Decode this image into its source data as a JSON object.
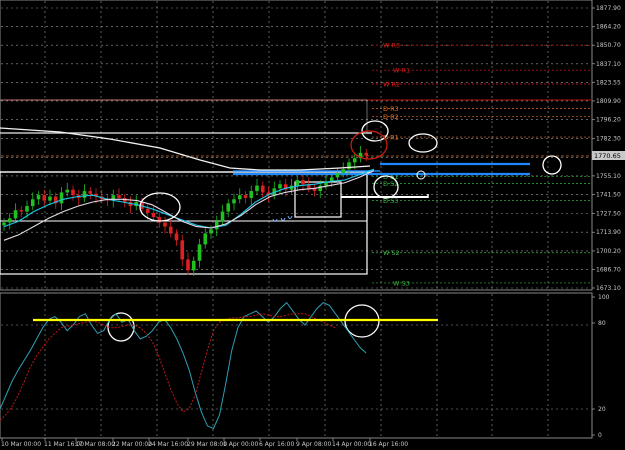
{
  "chart_data": [
    {
      "type": "line",
      "title": "",
      "price_scale": {
        "ticks": [
          "1877.90",
          "1864.20",
          "1850.70",
          "1837.10",
          "1823.55",
          "1809.90",
          "1796.20",
          "1782.30",
          "1768.40",
          "1755.10",
          "1741.50",
          "1727.50",
          "1713.90",
          "1700.20",
          "1686.70",
          "1673.10"
        ],
        "current_price": "1770.65",
        "ylim": [
          1673.1,
          1877.9
        ]
      },
      "time_axis": {
        "labels": [
          "10 Mar 00:00",
          "11 Mar 16:00",
          "17 Mar 08:00",
          "22 Mar 00:00",
          "24 Mar 16:00",
          "29 Mar 08:00",
          "1 Apr 00:00",
          "6 Apr 16:00",
          "9 Apr 08:00",
          "14 Apr 00:00",
          "16 Apr 16:00"
        ]
      },
      "levels": [
        {
          "label": "W R3",
          "price": 1850.7,
          "color": "#d81b1b"
        },
        {
          "label": "W R1",
          "price": 1832.4,
          "color": "#d81b1b"
        },
        {
          "label": "W R2",
          "price": 1822.3,
          "color": "#d81b1b"
        },
        {
          "label": "D R3",
          "price": 1804.5,
          "color": "#e0742a"
        },
        {
          "label": "D R2",
          "price": 1798.5,
          "color": "#e0742a"
        },
        {
          "label": "D R1",
          "price": 1783.5,
          "color": "#e0742a"
        },
        {
          "label": "D S1",
          "price": 1754.8,
          "color": "#3cb043"
        },
        {
          "label": "D S2",
          "price": 1749.6,
          "color": "#3cb043"
        },
        {
          "label": "D S3",
          "price": 1737.2,
          "color": "#3cb043"
        },
        {
          "label": "W S2",
          "price": 1698.9,
          "color": "#3cb043"
        },
        {
          "label": "W S3",
          "price": 1676.8,
          "color": "#3cb043"
        }
      ],
      "series": [
        {
          "values": [
            1718,
            1722,
            1729,
            1734,
            1738,
            1740,
            1741,
            1738,
            1736,
            1734,
            1731,
            1727,
            1723,
            1719,
            1717,
            1719,
            1727,
            1736,
            1742,
            1746,
            1748,
            1749,
            1751,
            1752,
            1756,
            1760
          ],
          "color": "#1ec8e8"
        },
        {
          "values": [
            1708,
            1712,
            1718,
            1724,
            1729,
            1733,
            1736,
            1738,
            1738,
            1737,
            1734,
            1728,
            1722,
            1718,
            1717,
            1720,
            1726,
            1734,
            1740,
            1743,
            1745,
            1746,
            1748,
            1750,
            1754,
            1759
          ],
          "color": "#e8d8e8"
        },
        {
          "values": [
            1785,
            1781,
            1777,
            1773,
            1770,
            1768,
            1766,
            1764,
            1762,
            1760,
            1758
          ],
          "color": "#f2f2f2"
        }
      ]
    },
    {
      "type": "line",
      "title": "",
      "y_ticks": [
        "100",
        "80",
        "20",
        "0"
      ],
      "ylim": [
        0,
        100
      ],
      "horizontal_line": 80,
      "series": [
        {
          "values": [
            20,
            30,
            40,
            48,
            55,
            62,
            70,
            78,
            84,
            86,
            82,
            76,
            80,
            86,
            88,
            80,
            74,
            76,
            84,
            88,
            82,
            84,
            76,
            70,
            72,
            76,
            82,
            84,
            78,
            70,
            60,
            48,
            32,
            18,
            8,
            6,
            16,
            38,
            62,
            78,
            86,
            88,
            90,
            86,
            82,
            86,
            92,
            96,
            90,
            84,
            80,
            86,
            92,
            96,
            94,
            88,
            82,
            76,
            70,
            64,
            60
          ],
          "color": "#2f9fb6"
        },
        {
          "values": [
            12,
            16,
            22,
            30,
            40,
            50,
            58,
            64,
            70,
            74,
            78,
            79,
            80,
            81,
            82,
            83,
            82,
            80,
            78,
            78,
            79,
            80,
            80,
            78,
            74,
            68,
            58,
            46,
            34,
            24,
            18,
            20,
            30,
            46,
            62,
            76,
            82,
            84,
            85,
            85,
            86,
            86,
            87,
            88,
            87,
            86,
            86,
            87,
            88,
            88,
            88,
            86,
            84,
            82,
            80,
            78
          ],
          "color": "#c31616"
        }
      ]
    }
  ]
}
